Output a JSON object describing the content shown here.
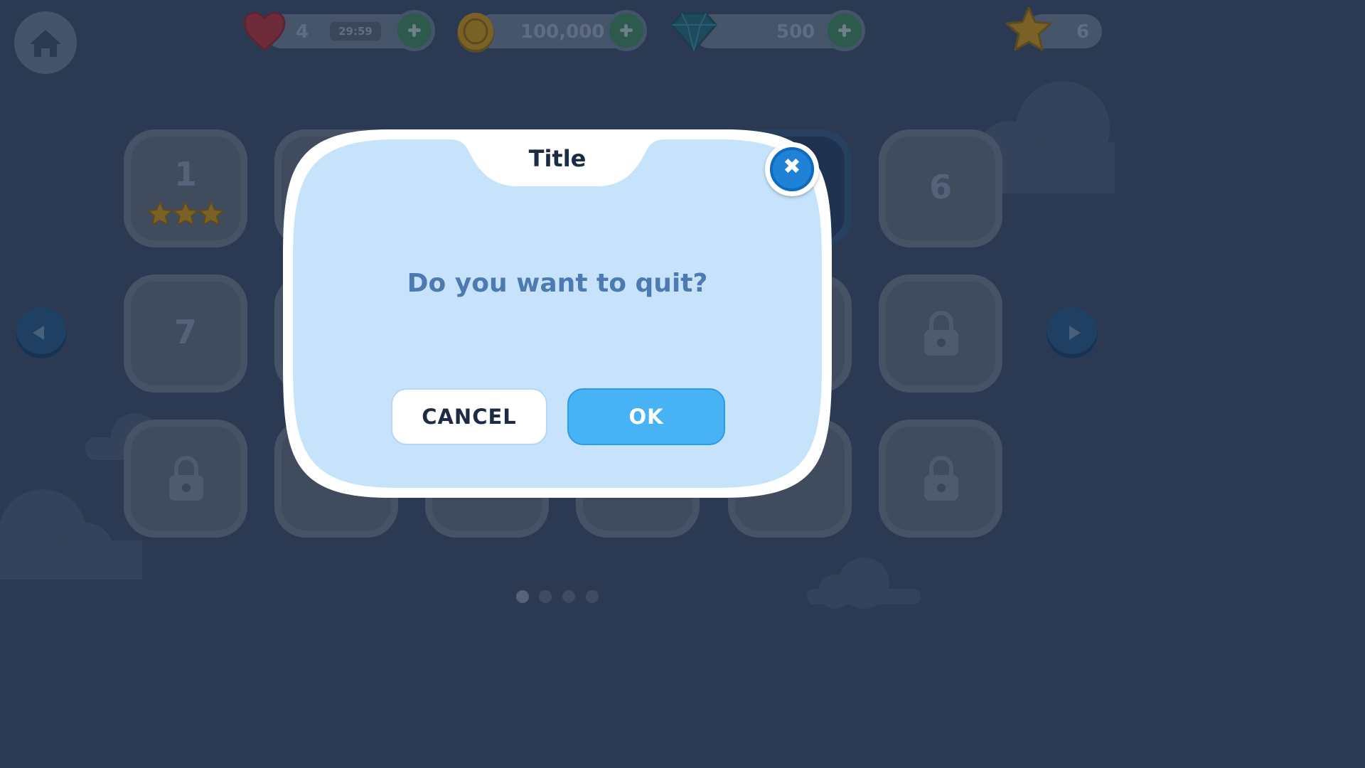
{
  "hud": {
    "lives": "4",
    "timer": "29:59",
    "coins": "100,000",
    "gems": "500",
    "stars": "6"
  },
  "level_grid": {
    "tiles": [
      {
        "label": "1",
        "stars": 3
      },
      {
        "label": "6"
      },
      {
        "label": "7"
      }
    ]
  },
  "pagination": {
    "pages": 4,
    "active": 0
  },
  "dialog": {
    "title": "Title",
    "message": "Do you want to quit?",
    "cancel_label": "CANCEL",
    "ok_label": "OK",
    "close_symbol": "✖"
  },
  "colors": {
    "background": "#2b3a52",
    "dialog_fill": "#c6e3fb",
    "ok_button": "#47b3f5",
    "close_button": "#1f82d6",
    "title_text": "#1d2b44",
    "message_text": "#4d7ab0"
  },
  "icons": [
    "home-icon",
    "heart-icon",
    "coin-icon",
    "gem-icon",
    "star-icon",
    "lock-icon",
    "plus-icon",
    "close-icon",
    "arrow-left-icon",
    "arrow-right-icon"
  ]
}
